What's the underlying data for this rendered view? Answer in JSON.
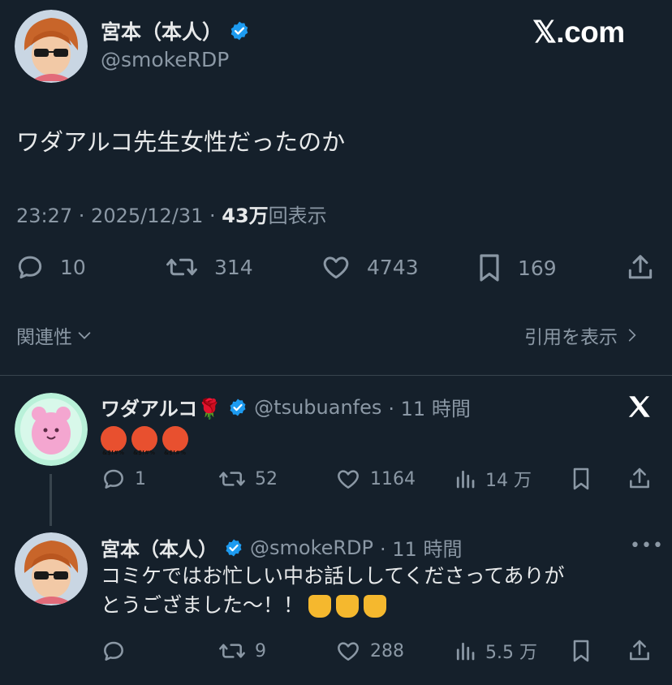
{
  "header": {
    "author_name": "宮本（本人）",
    "handle": "@smokeRDP",
    "brand": "𝕏.com",
    "brand_icon": "x-logo"
  },
  "tweet": {
    "text": "ワダアルコ先生女性だったのか",
    "time": "23:27 · 2025/12/31 · ",
    "views": "43万",
    "views_label": "回表示",
    "stats": {
      "replies": "10",
      "retweets": "314",
      "likes": "4743",
      "bookmarks": "169"
    }
  },
  "related": {
    "label": "関連性",
    "quotes_label": "引用を表示"
  },
  "replies": [
    {
      "name": "ワダアルコ🌹",
      "handle": "@tsubuanfes",
      "time": "· 11 時間",
      "text_icons": [
        "angry-face-emoji",
        "angry-face-emoji",
        "angry-face-emoji"
      ],
      "stats": {
        "replies": "1",
        "retweets": "52",
        "likes": "1164",
        "views": "14 万"
      }
    },
    {
      "name": "宮本（本人）",
      "handle": "@smokeRDP",
      "time": "· 11 時間",
      "line1": "コミケではお忙しい中お話ししてくださってありが",
      "line2": "とうござました～！！",
      "stats": {
        "replies": "",
        "retweets": "9",
        "likes": "288",
        "views": "5.5 万"
      }
    }
  ],
  "colors": {
    "background": "#15202b",
    "text": "#e7e9ea",
    "muted": "#8b98a5",
    "verified": "#1d9bf0"
  }
}
